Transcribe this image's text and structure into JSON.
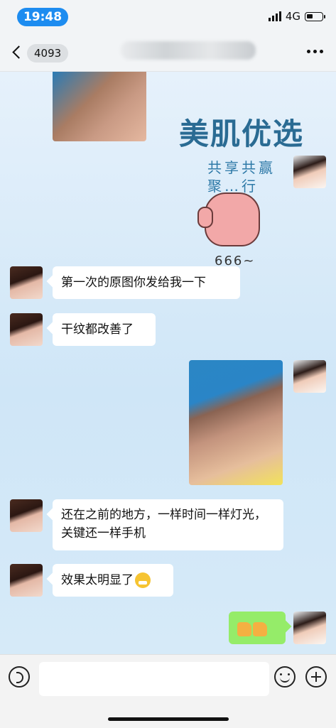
{
  "status_bar": {
    "time": "19:48",
    "network": "4G"
  },
  "nav": {
    "unread_count": "4093"
  },
  "sticker": {
    "title": "美肌优选",
    "subtitle": "共享共赢 聚…行",
    "caption": "666~"
  },
  "messages": [
    {
      "side": "left",
      "text": "第一次的原图你发给我一下"
    },
    {
      "side": "left",
      "text": "干纹都改善了"
    },
    {
      "side": "left",
      "text": "还在之前的地方，一样时间一样灯光，关键还一样手机"
    },
    {
      "side": "left",
      "text": "效果太明显了"
    }
  ],
  "emoji_names": [
    "grin-emoji",
    "thumbs-up-emoji"
  ]
}
